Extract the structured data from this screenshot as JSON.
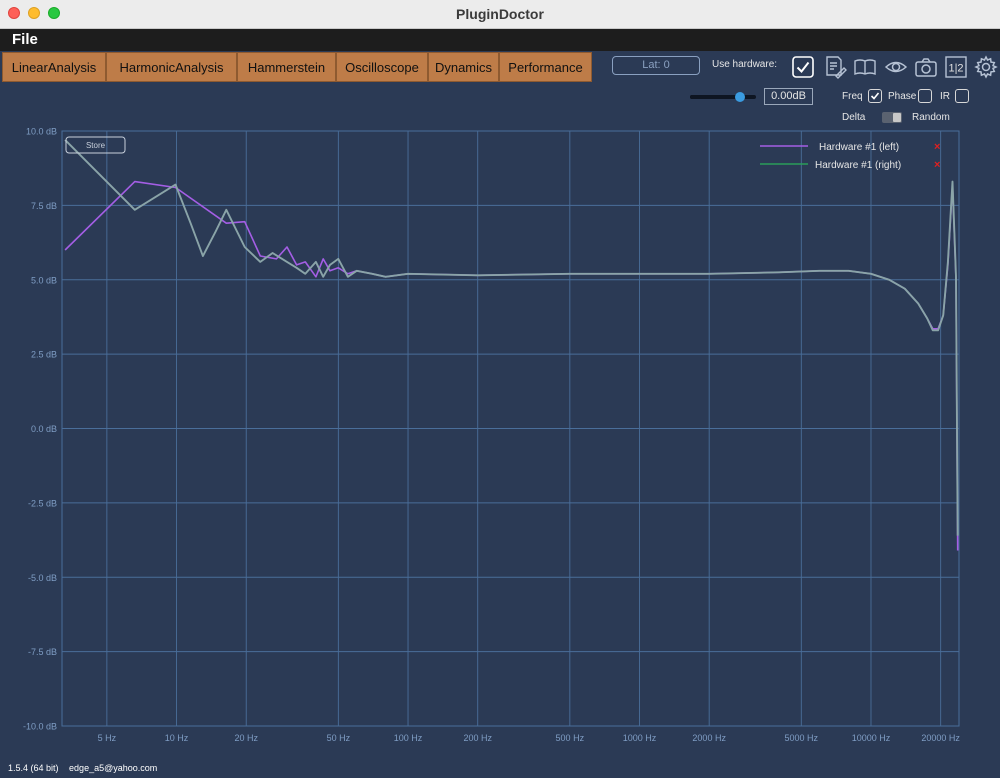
{
  "window": {
    "title": "PluginDoctor"
  },
  "menu": {
    "file": "File"
  },
  "tabs": [
    "LinearAnalysis",
    "HarmonicAnalysis",
    "Hammerstein",
    "Oscilloscope",
    "Dynamics",
    "Performance"
  ],
  "toolbar": {
    "latency": "Lat: 0",
    "use_hardware_label": "Use hardware:",
    "use_hardware_checked": true,
    "icons": [
      "notes-icon",
      "book-icon",
      "eye-icon",
      "camera-icon",
      "channel-1-2-icon",
      "gear-icon"
    ],
    "channel_label": "1|2"
  },
  "controls": {
    "gain_value": "0.00dB",
    "gain_level": 0.75,
    "freq_label": "Freq",
    "freq_checked": true,
    "phase_label": "Phase",
    "phase_checked": false,
    "ir_label": "IR",
    "ir_checked": false,
    "delta_label": "Delta",
    "random_label": "Random"
  },
  "store_button": "Store",
  "colors": {
    "background": "#2b3a55",
    "grid": "#4a6e9a",
    "series_left": "#a45ee5",
    "series_right_legend": "#2a9d5a",
    "series_right_trace": "#8aa4a8",
    "remove": "#e02020"
  },
  "chart_data": {
    "type": "line",
    "x_scale": "log",
    "xlim": [
      3.2,
      24000
    ],
    "ylim": [
      -10,
      10
    ],
    "grid": true,
    "legend_position": "top-right",
    "y_ticks": [
      "10.0 dB",
      "7.5 dB",
      "5.0 dB",
      "2.5 dB",
      "0.0 dB",
      "-2.5 dB",
      "-5.0 dB",
      "-7.5 dB",
      "-10.0 dB"
    ],
    "y_tick_values": [
      10,
      7.5,
      5,
      2.5,
      0,
      -2.5,
      -5,
      -7.5,
      -10
    ],
    "x_ticks": [
      "5 Hz",
      "10 Hz",
      "20 Hz",
      "50 Hz",
      "100 Hz",
      "200 Hz",
      "500 Hz",
      "1000 Hz",
      "2000 Hz",
      "5000 Hz",
      "10000 Hz",
      "20000 Hz"
    ],
    "x_tick_values": [
      5,
      10,
      20,
      50,
      100,
      200,
      500,
      1000,
      2000,
      5000,
      10000,
      20000
    ],
    "series": [
      {
        "name": "Hardware #1 (left)",
        "x": [
          3.3,
          6.6,
          9.9,
          16.4,
          19.7,
          23,
          27,
          30,
          33,
          36,
          40,
          43,
          46,
          50,
          55,
          60,
          70,
          80,
          100,
          200,
          500,
          1000,
          2000,
          4000,
          6000,
          8000,
          10000,
          12000,
          14000,
          16000,
          17500,
          18500,
          19500,
          20500,
          21500,
          22500,
          23300,
          23700
        ],
        "y": [
          6.0,
          8.3,
          8.1,
          6.9,
          6.95,
          5.8,
          5.7,
          6.1,
          5.5,
          5.6,
          5.1,
          5.7,
          5.3,
          5.4,
          5.2,
          5.3,
          5.2,
          5.1,
          5.2,
          5.15,
          5.2,
          5.2,
          5.2,
          5.25,
          5.3,
          5.3,
          5.2,
          5.0,
          4.7,
          4.2,
          3.7,
          3.35,
          3.35,
          3.8,
          5.5,
          8.2,
          5.0,
          -4.1
        ]
      },
      {
        "name": "Hardware #1 (right)",
        "x": [
          3.3,
          6.6,
          9.9,
          11.5,
          13,
          14.7,
          16.4,
          19.7,
          23,
          26,
          30,
          33,
          36,
          40,
          43,
          46,
          50,
          55,
          60,
          70,
          80,
          100,
          200,
          500,
          1000,
          2000,
          4000,
          6000,
          8000,
          10000,
          12000,
          14000,
          16000,
          17500,
          18500,
          19500,
          20500,
          21500,
          22500,
          23300,
          23700
        ],
        "y": [
          9.7,
          7.35,
          8.2,
          6.9,
          5.8,
          6.6,
          7.35,
          6.1,
          5.6,
          5.9,
          5.6,
          5.4,
          5.2,
          5.6,
          5.1,
          5.5,
          5.7,
          5.1,
          5.3,
          5.2,
          5.1,
          5.2,
          5.15,
          5.2,
          5.2,
          5.2,
          5.25,
          5.3,
          5.3,
          5.2,
          5.0,
          4.7,
          4.2,
          3.7,
          3.3,
          3.3,
          3.8,
          5.6,
          8.3,
          5.1,
          -3.6
        ]
      }
    ]
  },
  "status": {
    "version": "1.5.4 (64 bit)",
    "user": "edge_a5@yahoo.com"
  }
}
